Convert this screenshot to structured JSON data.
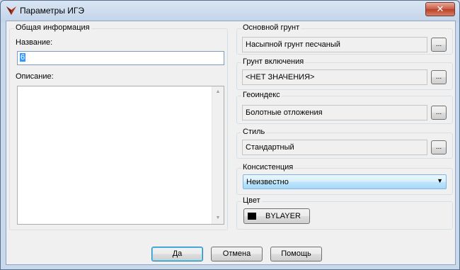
{
  "window": {
    "title": "Параметры ИГЭ",
    "close_label": "✕"
  },
  "general": {
    "group_title": "Общая информация",
    "name_label": "Название:",
    "name_value": "6",
    "description_label": "Описание:",
    "description_value": ""
  },
  "main_soil": {
    "title": "Основной грунт",
    "value": "Насыпной грунт песчаный",
    "button": "..."
  },
  "inclusion_soil": {
    "title": "Грунт включения",
    "value": "<НЕТ ЗНАЧЕНИЯ>",
    "button": "..."
  },
  "geoindex": {
    "title": "Геоиндекс",
    "value": "Болотные отложения",
    "button": "..."
  },
  "style": {
    "title": "Стиль",
    "value": "Стандартный",
    "button": "..."
  },
  "consistency": {
    "title": "Консистенция",
    "value": "Неизвестно"
  },
  "color": {
    "title": "Цвет",
    "value": "BYLAYER",
    "swatch_color": "#000000"
  },
  "buttons": {
    "ok": "Да",
    "cancel": "Отмена",
    "help": "Помощь"
  }
}
